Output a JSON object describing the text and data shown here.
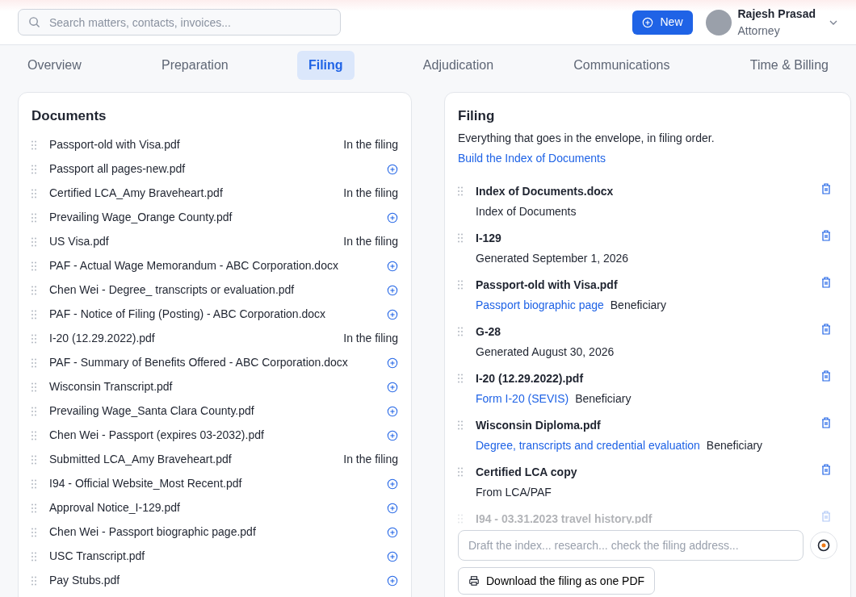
{
  "search": {
    "placeholder": "Search matters, contacts, invoices..."
  },
  "new_button": {
    "label": "New"
  },
  "user": {
    "name": "Rajesh Prasad",
    "role": "Attorney"
  },
  "tabs": [
    {
      "label": "Overview",
      "selected": false
    },
    {
      "label": "Preparation",
      "selected": false
    },
    {
      "label": "Filing",
      "selected": true
    },
    {
      "label": "Adjudication",
      "selected": false
    },
    {
      "label": "Communications",
      "selected": false
    },
    {
      "label": "Time & Billing",
      "selected": false
    }
  ],
  "documents": {
    "title": "Documents",
    "items": [
      {
        "name": "Passport-old with Visa.pdf",
        "in_filing": true,
        "status": "In the filing"
      },
      {
        "name": "Passport all pages-new.pdf",
        "in_filing": false
      },
      {
        "name": "Certified LCA_Amy Braveheart.pdf",
        "in_filing": true,
        "status": "In the filing"
      },
      {
        "name": "Prevailing Wage_Orange County.pdf",
        "in_filing": false
      },
      {
        "name": "US Visa.pdf",
        "in_filing": true,
        "status": "In the filing"
      },
      {
        "name": "PAF - Actual Wage Memorandum - ABC Corporation.docx",
        "in_filing": false
      },
      {
        "name": "Chen Wei - Degree_ transcripts or evaluation.pdf",
        "in_filing": false
      },
      {
        "name": "PAF - Notice of Filing (Posting) - ABC Corporation.docx",
        "in_filing": false
      },
      {
        "name": "I-20 (12.29.2022).pdf",
        "in_filing": true,
        "status": "In the filing"
      },
      {
        "name": "PAF - Summary of Benefits Offered - ABC Corporation.docx",
        "in_filing": false
      },
      {
        "name": "Wisconsin Transcript.pdf",
        "in_filing": false
      },
      {
        "name": "Prevailing Wage_Santa Clara County.pdf",
        "in_filing": false
      },
      {
        "name": "Chen Wei - Passport (expires 03-2032).pdf",
        "in_filing": false
      },
      {
        "name": "Submitted LCA_Amy Braveheart.pdf",
        "in_filing": true,
        "status": "In the filing"
      },
      {
        "name": "I94 - Official Website_Most Recent.pdf",
        "in_filing": false
      },
      {
        "name": "Approval Notice_I-129.pdf",
        "in_filing": false
      },
      {
        "name": "Chen Wei - Passport biographic page.pdf",
        "in_filing": false
      },
      {
        "name": "USC Transcript.pdf",
        "in_filing": false
      },
      {
        "name": "Pay Stubs.pdf",
        "in_filing": false
      }
    ]
  },
  "filing": {
    "title": "Filing",
    "description": "Everything that goes in the envelope, in filing order.",
    "build_link": "Build the Index of Documents",
    "items": [
      {
        "title": "Index of Documents.docx",
        "subtitle": "Index of Documents",
        "faded": false
      },
      {
        "title": "I-129",
        "subtitle": "Generated September 1, 2026",
        "faded": false
      },
      {
        "title": "Passport-old with Visa.pdf",
        "link": "Passport biographic page",
        "role": "Beneficiary",
        "faded": false
      },
      {
        "title": "G-28",
        "subtitle": "Generated August 30, 2026",
        "faded": false
      },
      {
        "title": "I-20 (12.29.2022).pdf",
        "link": "Form I-20 (SEVIS)",
        "role": "Beneficiary",
        "faded": false
      },
      {
        "title": "Wisconsin Diploma.pdf",
        "link": "Degree, transcripts and credential evaluation",
        "role": "Beneficiary",
        "faded": false
      },
      {
        "title": "Certified LCA copy",
        "subtitle": "From LCA/PAF",
        "faded": false
      },
      {
        "title": "I94 - 03.31.2023 travel history.pdf",
        "faded": true
      }
    ],
    "prompt": {
      "placeholder": "Draft the index... research... check the filing address..."
    },
    "download_button": "Download the filing as one PDF"
  }
}
